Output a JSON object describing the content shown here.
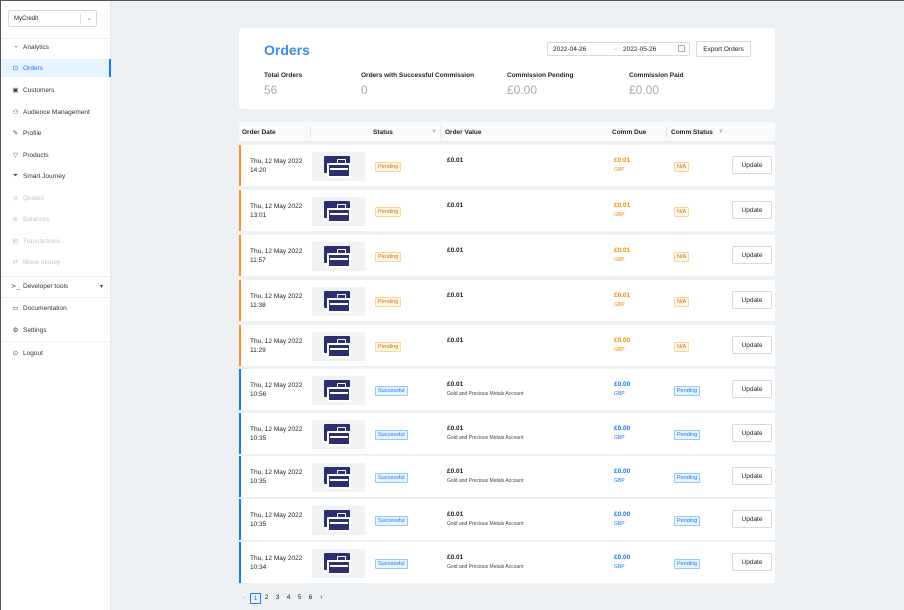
{
  "sidebar": {
    "org": "MyCredit",
    "items": [
      {
        "label": "Analytics",
        "icon": "analytics-icon",
        "glyph": "◔"
      },
      {
        "label": "Orders",
        "icon": "orders-icon",
        "glyph": "⊡"
      },
      {
        "label": "Customers",
        "icon": "customers-icon",
        "glyph": "▣"
      },
      {
        "label": "Audience Management",
        "icon": "audience-icon",
        "glyph": "⚇"
      },
      {
        "label": "Profile",
        "icon": "profile-edit-icon",
        "glyph": "✎"
      },
      {
        "label": "Products",
        "icon": "products-icon",
        "glyph": "▽"
      },
      {
        "label": "Smart Journey",
        "icon": "funnel-icon",
        "glyph": "⏷"
      },
      {
        "label": "Quotes",
        "icon": "quotes-icon",
        "glyph": "⊜"
      },
      {
        "label": "Balances",
        "icon": "balances-icon",
        "glyph": "⊕"
      },
      {
        "label": "Transactions",
        "icon": "transactions-icon",
        "glyph": "▤"
      },
      {
        "label": "Move money",
        "icon": "move-money-icon",
        "glyph": "⇄"
      },
      {
        "label": "Developer tools",
        "icon": "terminal-icon",
        "glyph": "≻_"
      },
      {
        "label": "Documentation",
        "icon": "documentation-icon",
        "glyph": "▭"
      },
      {
        "label": "Settings",
        "icon": "settings-icon",
        "glyph": "⚙"
      },
      {
        "label": "Logout",
        "icon": "logout-icon",
        "glyph": "⊙"
      }
    ]
  },
  "header": {
    "title": "Orders",
    "date_from": "2022-04-26",
    "date_to": "2022-05-26",
    "export_label": "Export Orders"
  },
  "stats": [
    {
      "label": "Total Orders",
      "value": "56"
    },
    {
      "label": "Orders with Successful Commission",
      "value": "0"
    },
    {
      "label": "Commission Pending",
      "value": "£0.00"
    },
    {
      "label": "Commission Paid",
      "value": "£0.00"
    }
  ],
  "table": {
    "columns": [
      "Order Date",
      "Status",
      "Order Value",
      "Comm Due",
      "Comm Status"
    ],
    "update_label": "Update",
    "rows": [
      {
        "date": "Thu, 12 May 2022",
        "time": "14:20",
        "status": "Pending",
        "value": "£0.01",
        "product": "",
        "comm": "£0.01",
        "currency": "GBP",
        "comm_status": "N/A"
      },
      {
        "date": "Thu, 12 May 2022",
        "time": "13:01",
        "status": "Pending",
        "value": "£0.01",
        "product": "",
        "comm": "£0.01",
        "currency": "GBP",
        "comm_status": "N/A"
      },
      {
        "date": "Thu, 12 May 2022",
        "time": "11:57",
        "status": "Pending",
        "value": "£0.01",
        "product": "",
        "comm": "£0.01",
        "currency": "GBP",
        "comm_status": "N/A"
      },
      {
        "date": "Thu, 12 May 2022",
        "time": "11:38",
        "status": "Pending",
        "value": "£0.01",
        "product": "",
        "comm": "£0.01",
        "currency": "GBP",
        "comm_status": "N/A"
      },
      {
        "date": "Thu, 12 May 2022",
        "time": "11:29",
        "status": "Pending",
        "value": "£0.01",
        "product": "",
        "comm": "£0.00",
        "currency": "GBP",
        "comm_status": "N/A"
      },
      {
        "date": "Thu, 12 May 2022",
        "time": "10:56",
        "status": "Successful",
        "value": "£0.01",
        "product": "Gold and Precious Metals Account",
        "comm": "£0.00",
        "currency": "GBP",
        "comm_status": "Pending"
      },
      {
        "date": "Thu, 12 May 2022",
        "time": "10:35",
        "status": "Successful",
        "value": "£0.01",
        "product": "Gold and Precious Metals Account",
        "comm": "£0.00",
        "currency": "GBP",
        "comm_status": "Pending"
      },
      {
        "date": "Thu, 12 May 2022",
        "time": "10:35",
        "status": "Successful",
        "value": "£0.01",
        "product": "Gold and Precious Metals Account",
        "comm": "£0.00",
        "currency": "GBP",
        "comm_status": "Pending"
      },
      {
        "date": "Thu, 12 May 2022",
        "time": "10:35",
        "status": "Successful",
        "value": "£0.01",
        "product": "Gold and Precious Metals Account",
        "comm": "£0.00",
        "currency": "GBP",
        "comm_status": "Pending"
      },
      {
        "date": "Thu, 12 May 2022",
        "time": "10:34",
        "status": "Successful",
        "value": "£0.01",
        "product": "Gold and Precious Metals Account",
        "comm": "£0.00",
        "currency": "GBP",
        "comm_status": "Pending"
      }
    ]
  },
  "pagination": {
    "prev": "‹",
    "next": "›",
    "pages": [
      "1",
      "2",
      "3",
      "4",
      "5",
      "6"
    ],
    "current": "1"
  },
  "colors": {
    "accent": "#1677ff",
    "pending": "#f5922f",
    "title": "#3d8be8"
  }
}
